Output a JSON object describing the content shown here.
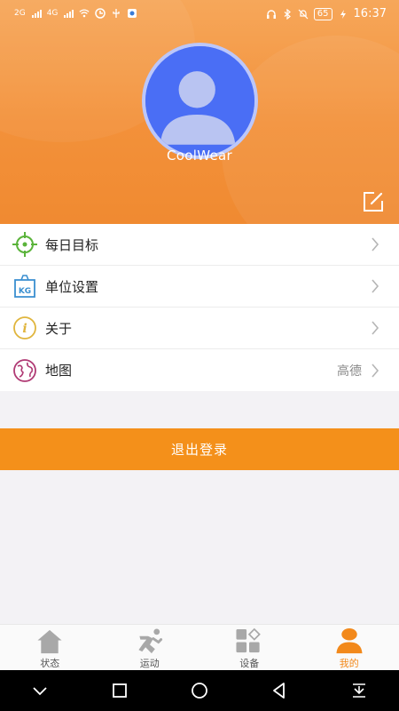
{
  "status_bar": {
    "signal_left": "2G",
    "signal_left2": "4G",
    "battery": "65",
    "time": "16:37"
  },
  "profile": {
    "username": "CoolWear"
  },
  "menu": [
    {
      "label": "每日目标",
      "value": ""
    },
    {
      "label": "单位设置",
      "value": ""
    },
    {
      "label": "关于",
      "value": ""
    },
    {
      "label": "地图",
      "value": "高德"
    }
  ],
  "logout_label": "退出登录",
  "tabs": [
    {
      "label": "状态",
      "icon": "home-icon"
    },
    {
      "label": "运动",
      "icon": "running-icon"
    },
    {
      "label": "设备",
      "icon": "devices-icon"
    },
    {
      "label": "我的",
      "icon": "person-icon",
      "active": true
    }
  ],
  "colors": {
    "accent": "#f4901a",
    "header": "#f3913a",
    "active_tab": "#f2891b"
  }
}
